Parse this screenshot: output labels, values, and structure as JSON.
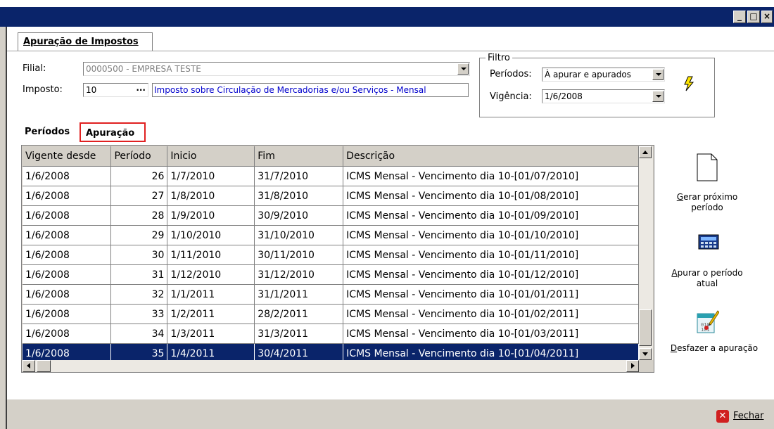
{
  "window": {
    "title": "",
    "controls": [
      "minimize",
      "maximize",
      "close"
    ]
  },
  "main_tab": {
    "label": "Apuração de Impostos"
  },
  "form": {
    "filial_label": "Filial:",
    "filial_value": "0000500 - EMPRESA TESTE",
    "imposto_label": "Imposto:",
    "imposto_code": "10",
    "imposto_lookup": "···",
    "imposto_desc": "Imposto sobre Circulação de Mercadorias e/ou Serviços - Mensal"
  },
  "filtro": {
    "legend": "Filtro",
    "periodos_label": "Períodos:",
    "periodos_value": "À apurar e apurados",
    "vigencia_label": "Vigência:",
    "vigencia_value": "1/6/2008",
    "run_icon": "lightning-icon"
  },
  "subtabs": {
    "periodos": "Períodos",
    "apuracao": "Apuração"
  },
  "grid": {
    "columns": [
      "Vigente desde",
      "Período",
      "Inicio",
      "Fim",
      "Descrição"
    ],
    "rows": [
      [
        "1/6/2008",
        "26",
        "1/7/2010",
        "31/7/2010",
        "ICMS Mensal - Vencimento dia 10-[01/07/2010]"
      ],
      [
        "1/6/2008",
        "27",
        "1/8/2010",
        "31/8/2010",
        "ICMS Mensal - Vencimento dia 10-[01/08/2010]"
      ],
      [
        "1/6/2008",
        "28",
        "1/9/2010",
        "30/9/2010",
        "ICMS Mensal - Vencimento dia 10-[01/09/2010]"
      ],
      [
        "1/6/2008",
        "29",
        "1/10/2010",
        "31/10/2010",
        "ICMS Mensal - Vencimento dia 10-[01/10/2010]"
      ],
      [
        "1/6/2008",
        "30",
        "1/11/2010",
        "30/11/2010",
        "ICMS Mensal - Vencimento dia 10-[01/11/2010]"
      ],
      [
        "1/6/2008",
        "31",
        "1/12/2010",
        "31/12/2010",
        "ICMS Mensal - Vencimento dia 10-[01/12/2010]"
      ],
      [
        "1/6/2008",
        "32",
        "1/1/2011",
        "31/1/2011",
        "ICMS Mensal - Vencimento dia 10-[01/01/2011]"
      ],
      [
        "1/6/2008",
        "33",
        "1/2/2011",
        "28/2/2011",
        "ICMS Mensal - Vencimento dia 10-[01/02/2011]"
      ],
      [
        "1/6/2008",
        "34",
        "1/3/2011",
        "31/3/2011",
        "ICMS Mensal - Vencimento dia 10-[01/03/2011]"
      ],
      [
        "1/6/2008",
        "35",
        "1/4/2011",
        "30/4/2011",
        "ICMS Mensal - Vencimento dia 10-[01/04/2011]"
      ]
    ],
    "selected_row": 9
  },
  "actions": {
    "gerar_line1": "Gerar próximo",
    "gerar_line2": "período",
    "apurar_line1": "Apurar o período",
    "apurar_line2": "atual",
    "desfazer": "Desfazer a apuração"
  },
  "footer": {
    "fechar": "Fechar"
  },
  "colors": {
    "titlebar": "#0a246a",
    "selection": "#0a246a",
    "highlight_border": "#e02020",
    "link_text": "#0000cc"
  }
}
